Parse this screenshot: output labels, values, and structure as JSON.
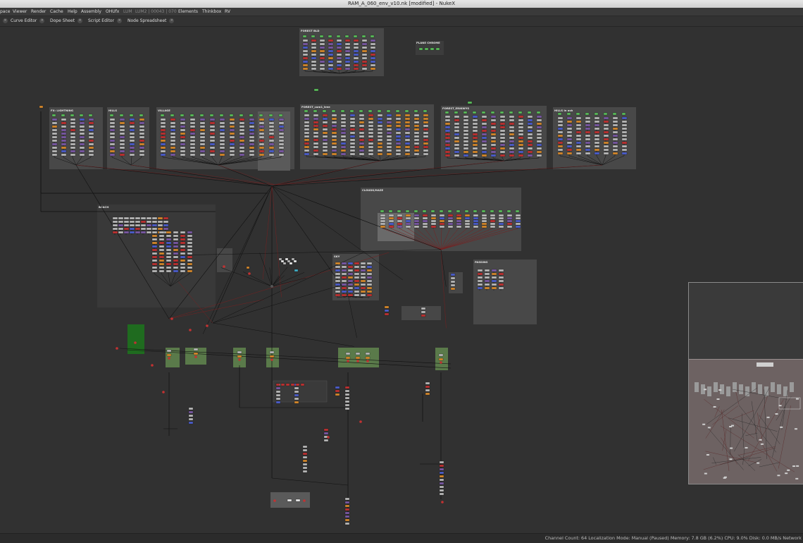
{
  "window": {
    "title": "RAM_A_060_env_v10.nk [modified] - NukeX"
  },
  "menu": {
    "items": [
      {
        "label": "pace",
        "dim": false
      },
      {
        "label": "Viewer",
        "dim": false
      },
      {
        "label": "Render",
        "dim": false
      },
      {
        "label": "Cache",
        "dim": false
      },
      {
        "label": "Help",
        "dim": false
      },
      {
        "label": "Assembly",
        "dim": false
      },
      {
        "label": "OHUfx",
        "dim": false
      },
      {
        "label": "LUM",
        "dim": true
      },
      {
        "label": "LUM2 | 00043 | 070",
        "dim": true
      },
      {
        "label": "Elements",
        "dim": false
      },
      {
        "label": "Thinkbox",
        "dim": false
      },
      {
        "label": "RV",
        "dim": false
      }
    ]
  },
  "tabs": [
    {
      "label": "Curve Editor"
    },
    {
      "label": "Dope Sheet"
    },
    {
      "label": "Script Editor"
    },
    {
      "label": "Node Spreadsheet"
    }
  ],
  "tab_close_glyph": "×",
  "left_tab_close_glyph": "×",
  "backdrops": [
    {
      "label": "FOREST BLD"
    },
    {
      "label": "FX: LIGHTNING"
    },
    {
      "label": "HILLS"
    },
    {
      "label": "VILLAGE"
    },
    {
      "label": "FOREST_cam1_tree"
    },
    {
      "label": "FOREST_ERIKWYS"
    },
    {
      "label": "HILLS in ash"
    },
    {
      "label": "BEACH"
    },
    {
      "label": "CLOUDS/HAZE"
    },
    {
      "label": "SKY"
    },
    {
      "label": "PASSING"
    },
    {
      "label": "PLANE CHROME"
    }
  ],
  "status": {
    "text": "Channel Count: 64  Localization Mode: Manual (Paused)  Memory: 7.8 GB (6.2%)  CPU: 9.0%  Disk: 0.0 MB/s  Network"
  },
  "colors": {
    "graph_bg": "#313131",
    "backdrop_grey": "#4a4a4a",
    "backdrop_green": "#4d6b3c",
    "node_grey": "#bcbcbc",
    "node_blue": "#4d5fd0",
    "node_green": "#5cc15c",
    "node_red": "#c23232",
    "node_orange": "#d98a2b",
    "wire_black": "#111111",
    "wire_red": "#7a1f1f"
  }
}
